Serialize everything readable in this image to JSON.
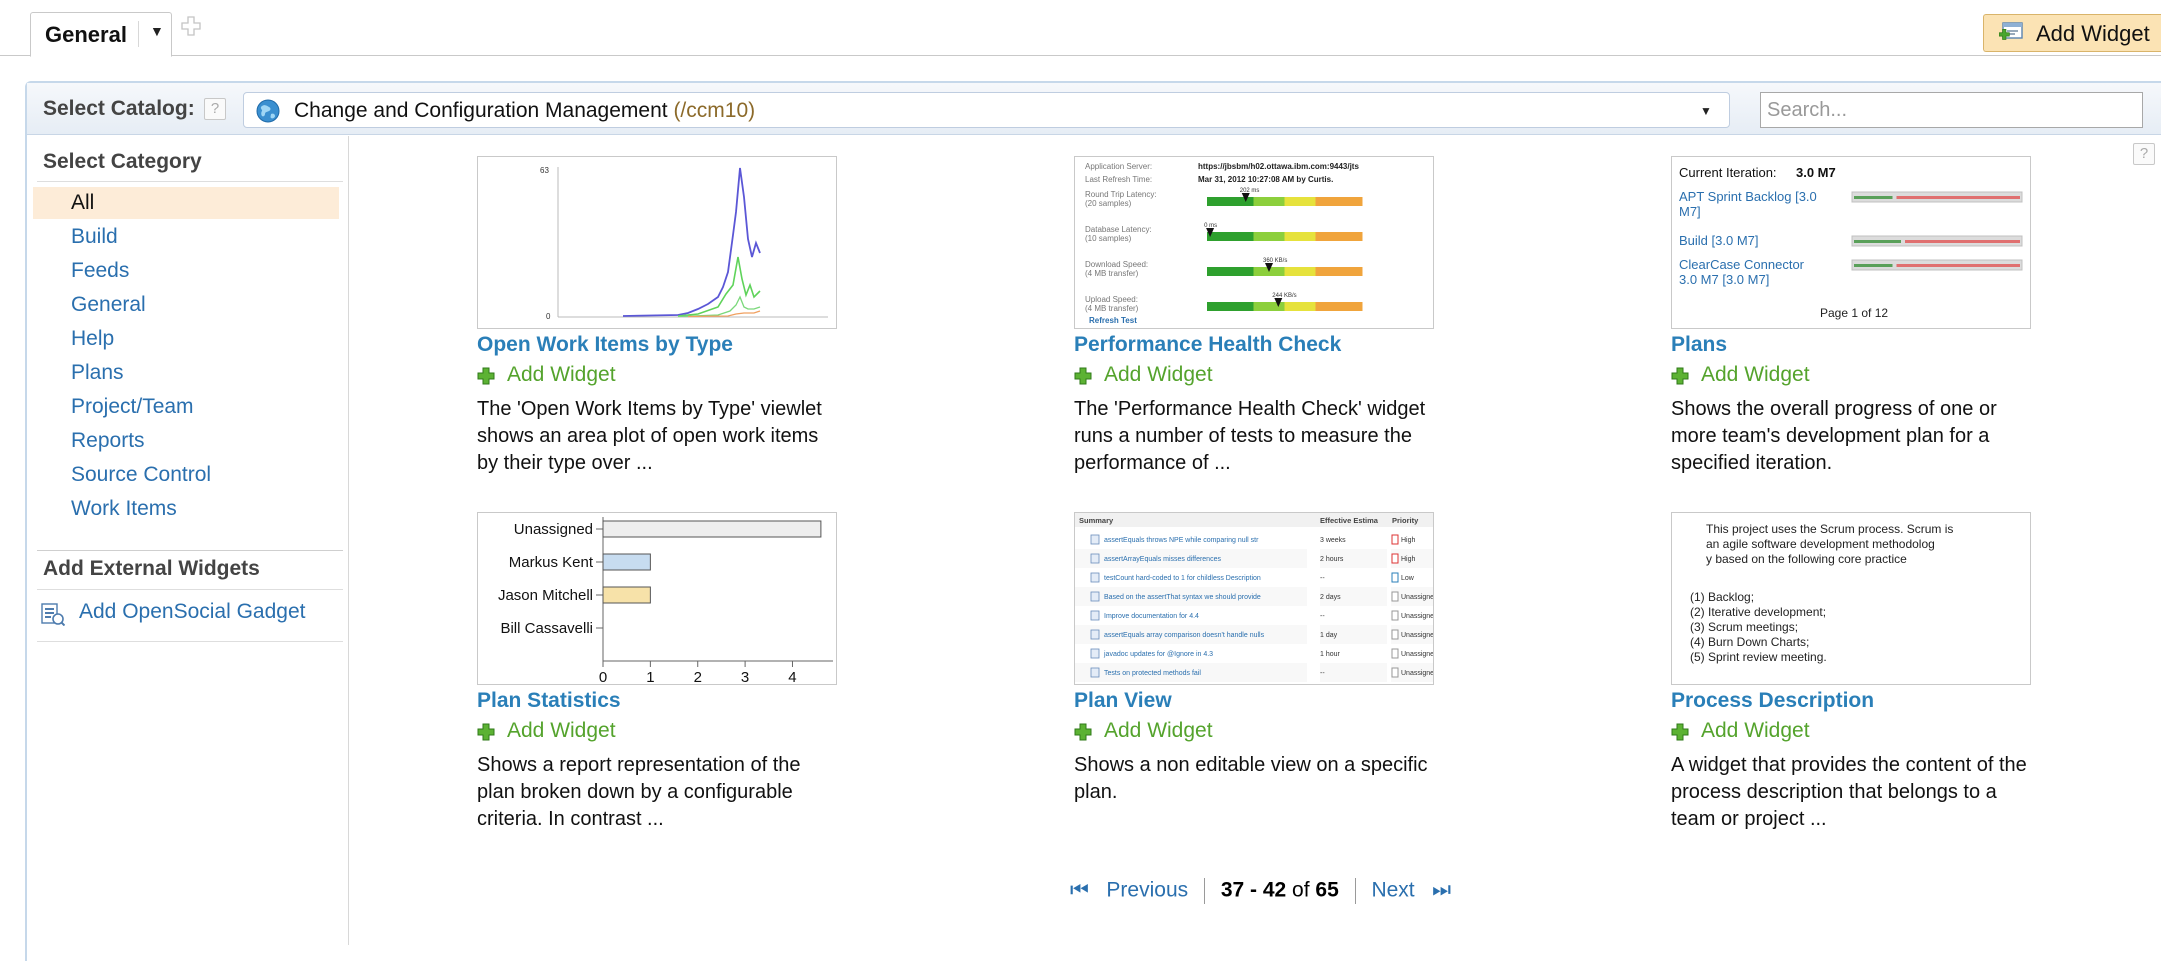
{
  "tabs": {
    "active_label": "General",
    "add_widget_label": "Add Widget"
  },
  "catalog": {
    "label": "Select Catalog:",
    "help": "?",
    "selected_name": "Change and Configuration Management",
    "selected_path": "(/ccm10)",
    "search_placeholder": "Search...",
    "close": "☒"
  },
  "sidebar": {
    "category_heading": "Select Category",
    "categories": [
      {
        "label": "All",
        "active": true
      },
      {
        "label": "Build"
      },
      {
        "label": "Feeds"
      },
      {
        "label": "General"
      },
      {
        "label": "Help"
      },
      {
        "label": "Plans"
      },
      {
        "label": "Project/Team"
      },
      {
        "label": "Reports"
      },
      {
        "label": "Source Control"
      },
      {
        "label": "Work Items"
      }
    ],
    "external_heading": "Add External Widgets",
    "opensocial_label": "Add OpenSocial Gadget"
  },
  "widgets": [
    {
      "title": "Open Work Items by Type",
      "add_label": "Add Widget",
      "description": "The 'Open Work Items by Type' viewlet shows an area plot of open work items by their type over ...",
      "preview": {
        "ymax_label": "63",
        "ymin_label": "0"
      }
    },
    {
      "title": "Performance Health Check",
      "add_label": "Add Widget",
      "description": "The 'Performance Health Check' widget runs a number of tests to measure the performance of ...",
      "preview": {
        "rows": [
          {
            "label": "Application Server:",
            "value": "https://jbsbm/h02.ottawa.ibm.com:9443/jts"
          },
          {
            "label": "Last Refresh Time:",
            "value": "Mar 31, 2012 10:27:08 AM by Curtis."
          }
        ],
        "gauges": [
          {
            "label": "Round Trip Latency:",
            "sub": "(20 samples)",
            "reading": "202 ms"
          },
          {
            "label": "Database Latency:",
            "sub": "(10 samples)",
            "reading": "0 ms"
          },
          {
            "label": "Download Speed:",
            "sub": "(4 MB transfer)",
            "reading": "360 KB/s"
          },
          {
            "label": "Upload Speed:",
            "sub": "(4 MB transfer)",
            "reading": "244 KB/s"
          }
        ],
        "refresh": "Refresh Test"
      }
    },
    {
      "title": "Plans",
      "add_label": "Add Widget",
      "description": "Shows the overall progress of one or more team's development plan for a specified iteration.",
      "preview": {
        "iteration_label": "Current Iteration:",
        "iteration_value": "3.0 M7",
        "items": [
          {
            "name": "APT Sprint Backlog [3.0 M7]",
            "progress": 0.25
          },
          {
            "name": "Build [3.0 M7]",
            "progress": 0.3
          },
          {
            "name": "ClearCase Connector 3.0 M7 [3.0 M7]",
            "progress": 0.25
          }
        ],
        "page": "Page 1 of 12"
      }
    },
    {
      "title": "Plan Statistics",
      "add_label": "Add Widget",
      "description": "Shows a report representation of the plan broken down by a configurable criteria. In contrast ...",
      "preview": {
        "categories": [
          "Unassigned",
          "Markus Kent",
          "Jason Mitchell",
          "Bill Cassavelli"
        ],
        "values": [
          4.6,
          1,
          1,
          0
        ],
        "colors": [
          "#eeeeee",
          "#c7dcf0",
          "#f7e2a9",
          "#ffffff"
        ],
        "ticks": [
          "0",
          "1",
          "2",
          "3",
          "4"
        ],
        "xmax": 4.75
      }
    },
    {
      "title": "Plan View",
      "add_label": "Add Widget",
      "description": "Shows a non editable view on a specific plan.",
      "preview": {
        "headers": [
          "Summary",
          "Effective Estima",
          "Priority"
        ],
        "rows": [
          {
            "summary": "assertEquals throws NPE while comparing null str",
            "estimate": "3 weeks",
            "priority": "High",
            "pcolor": "#d33"
          },
          {
            "summary": "assertArrayEquals misses differences",
            "estimate": "2 hours",
            "priority": "High",
            "pcolor": "#d33"
          },
          {
            "summary": "testCount hard-coded to 1 for childless Description",
            "estimate": "--",
            "priority": "Low",
            "pcolor": "#2a7fb8"
          },
          {
            "summary": "Based on the assertThat syntax we should provide",
            "estimate": "2 days",
            "priority": "Unassigned",
            "pcolor": "#999"
          },
          {
            "summary": "Improve documentation for 4.4",
            "estimate": "--",
            "priority": "Unassigned",
            "pcolor": "#999"
          },
          {
            "summary": "assertEquals array comparison doesn't handle nulls",
            "estimate": "1 day",
            "priority": "Unassigned",
            "pcolor": "#999"
          },
          {
            "summary": "javadoc updates for @Ignore in 4.3",
            "estimate": "1 hour",
            "priority": "Unassigned",
            "pcolor": "#999"
          },
          {
            "summary": "Tests on protected methods fail",
            "estimate": "--",
            "priority": "Unassigned",
            "pcolor": "#999"
          }
        ]
      }
    },
    {
      "title": "Process Description",
      "add_label": "Add Widget",
      "description": "A widget that provides the content of the process description that belongs to a team or project ...",
      "preview": {
        "intro": "This project uses the Scrum process. Scrum is an agile software development methodology based on the following core practices:",
        "practices": [
          "(1) Backlog;",
          "(2) Iterative development;",
          "(3) Scrum meetings;",
          "(4) Burn Down Charts;",
          "(5) Sprint review meeting."
        ]
      }
    }
  ],
  "pagination": {
    "previous": "Previous",
    "range": "37 - 42",
    "of": "of",
    "total": "65",
    "next": "Next"
  }
}
